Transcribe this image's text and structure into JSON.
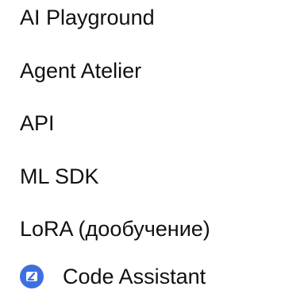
{
  "menu": {
    "items": [
      {
        "label": "AI Playground"
      },
      {
        "label": "Agent Atelier"
      },
      {
        "label": "API"
      },
      {
        "label": "ML SDK"
      },
      {
        "label": "LoRA (дообучение)"
      },
      {
        "label": "Code Assistant",
        "icon": "code-assistant-icon"
      }
    ]
  },
  "colors": {
    "text": "#111111",
    "icon_badge": "#3d6fe0"
  }
}
